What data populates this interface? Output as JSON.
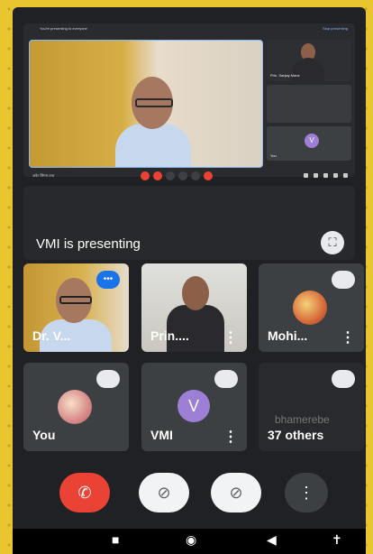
{
  "shared_screen": {
    "top_left_text": "You're presenting to everyone",
    "top_right_text": "Stop presenting",
    "thumb_label": "Prin. Sanjay Mane",
    "thumb_you_label": "You",
    "thumb_v_letter": "V",
    "bottom_left_text": "अवेट सिंगस-रल्ड"
  },
  "presenting_banner": {
    "text": "VMI is presenting"
  },
  "participants": [
    {
      "label": "Dr. V..."
    },
    {
      "label": "Prin...."
    },
    {
      "label": "Mohi..."
    },
    {
      "label": "You"
    },
    {
      "label": "VMI",
      "avatar_letter": "V"
    },
    {
      "label": "37 others",
      "faded": "bhamerebe"
    }
  ],
  "controls": {
    "end_icon": "✆",
    "camera_icon": "⊘",
    "mic_icon": "⊘",
    "more_icon": "⋮"
  },
  "navbar": {
    "square": "■",
    "circle": "◉",
    "back": "◀",
    "person": "✝"
  },
  "colors": {
    "accent": "#1a73e8",
    "danger": "#ea4335",
    "bg": "#202124"
  }
}
